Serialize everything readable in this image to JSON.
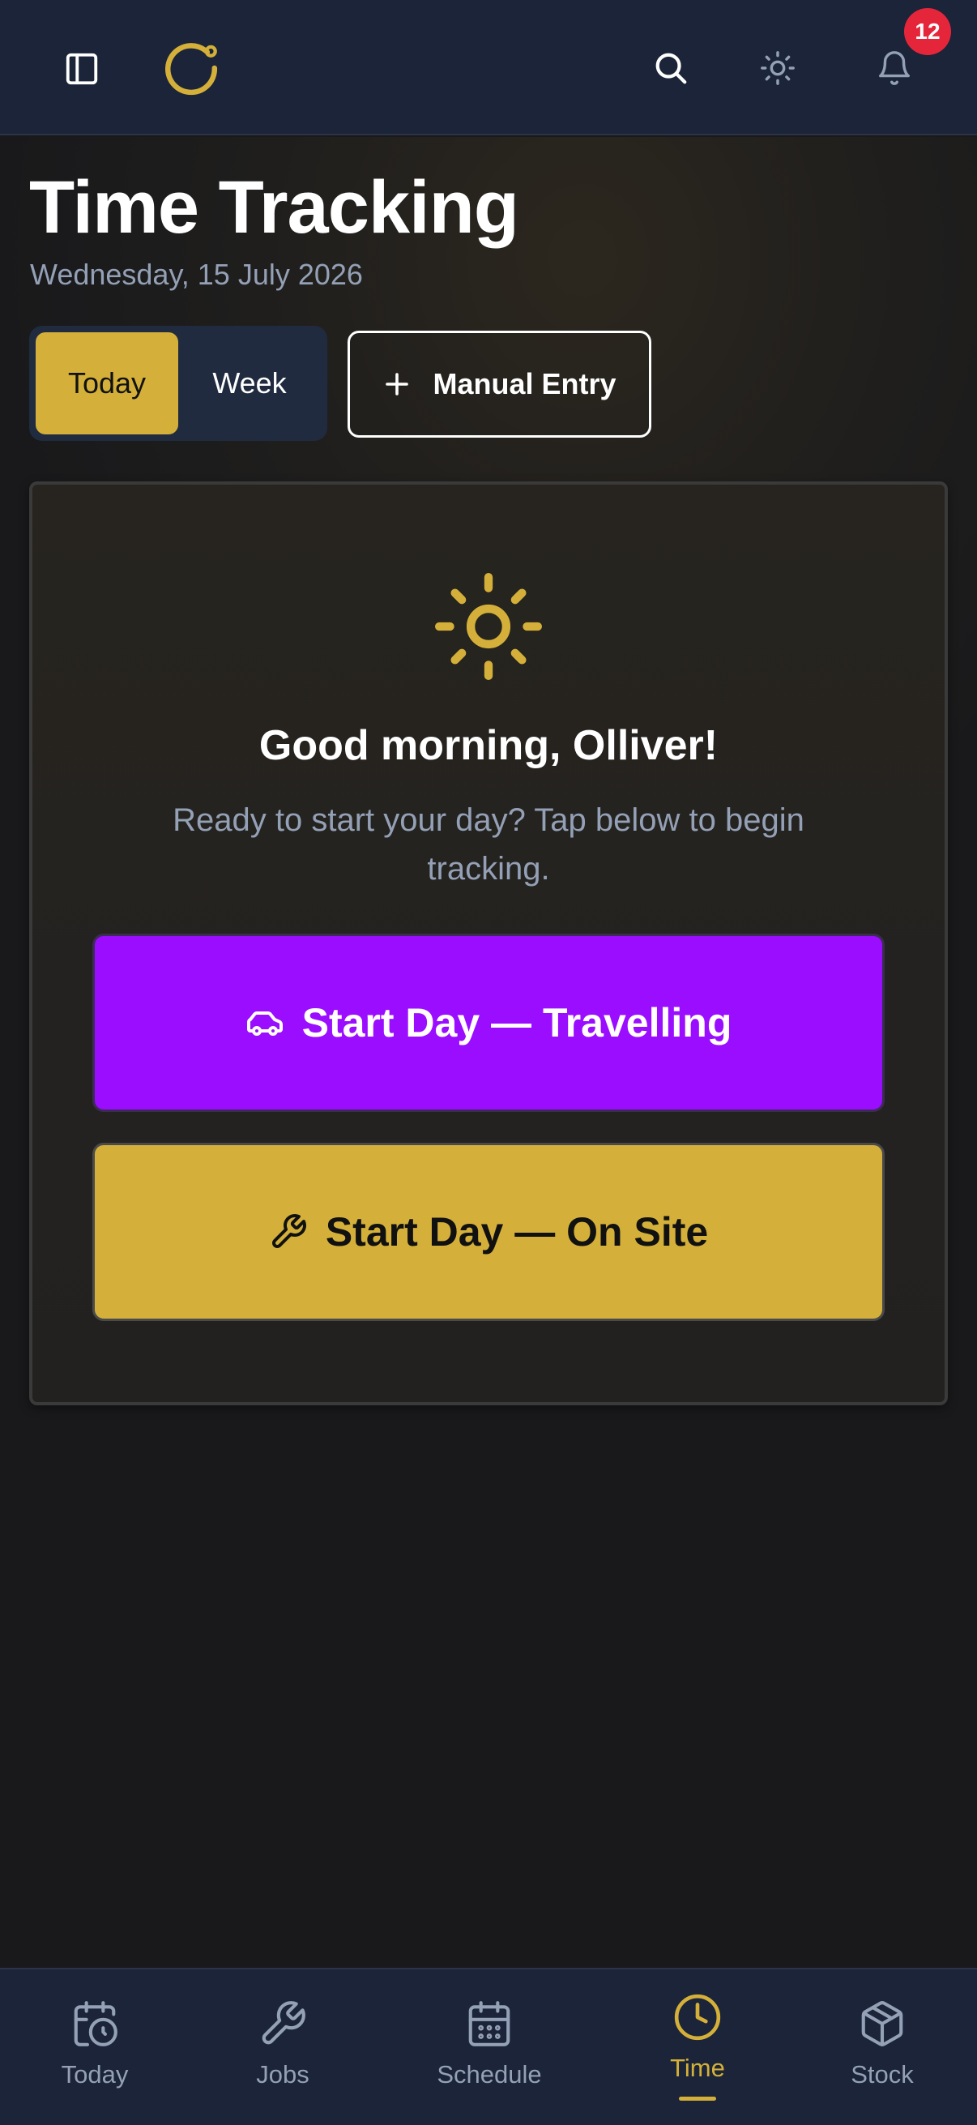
{
  "header": {
    "notification_count": "12",
    "icons": [
      "sidebar-toggle-icon",
      "app-logo",
      "search-icon",
      "sun-icon",
      "bell-icon"
    ]
  },
  "page": {
    "title": "Time Tracking",
    "date": "Wednesday, 15 July 2026"
  },
  "view_toggle": {
    "options": [
      {
        "label": "Today",
        "selected": true
      },
      {
        "label": "Week",
        "selected": false
      }
    ]
  },
  "manual_entry": {
    "label": "Manual Entry",
    "icon": "plus-icon"
  },
  "start_card": {
    "icon": "sun-icon",
    "greeting": "Good morning, Olliver!",
    "prompt": "Ready to start your day? Tap below to begin tracking.",
    "travel_button": {
      "label": "Start Day — Travelling",
      "icon": "car-icon"
    },
    "onsite_button": {
      "label": "Start Day — On Site",
      "icon": "wrench-icon"
    }
  },
  "bottom_nav": {
    "items": [
      {
        "label": "Today",
        "icon": "calendar-clock-icon",
        "active": false
      },
      {
        "label": "Jobs",
        "icon": "wrench-icon",
        "active": false
      },
      {
        "label": "Schedule",
        "icon": "calendar-icon",
        "active": false
      },
      {
        "label": "Time",
        "icon": "clock-icon",
        "active": true
      },
      {
        "label": "Stock",
        "icon": "box-icon",
        "active": false
      }
    ]
  },
  "colors": {
    "accent": "#d4b03a",
    "travel": "#9a0dff",
    "topbar": "#1b2438",
    "badge": "#e5263a",
    "muted_text": "#93a0b5"
  }
}
